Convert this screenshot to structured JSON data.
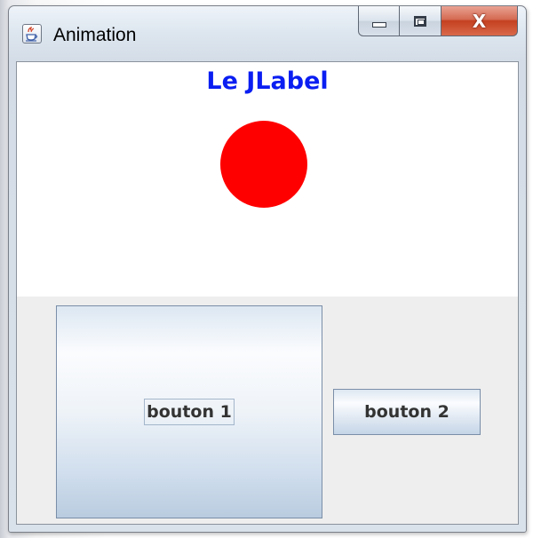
{
  "window": {
    "title": "Animation",
    "app_icon": "java-cup-icon",
    "controls": {
      "minimize_icon": "minimize-icon",
      "maximize_icon": "maximize-icon",
      "close_label": "X"
    }
  },
  "label_panel": {
    "label_text": "Le JLabel",
    "label_color": "#0a1ef2",
    "ball_color": "#ff0000",
    "background": "#ffffff"
  },
  "button_panel": {
    "background": "#eeeeee",
    "button1_label": "bouton 1",
    "button2_label": "bouton 2"
  }
}
